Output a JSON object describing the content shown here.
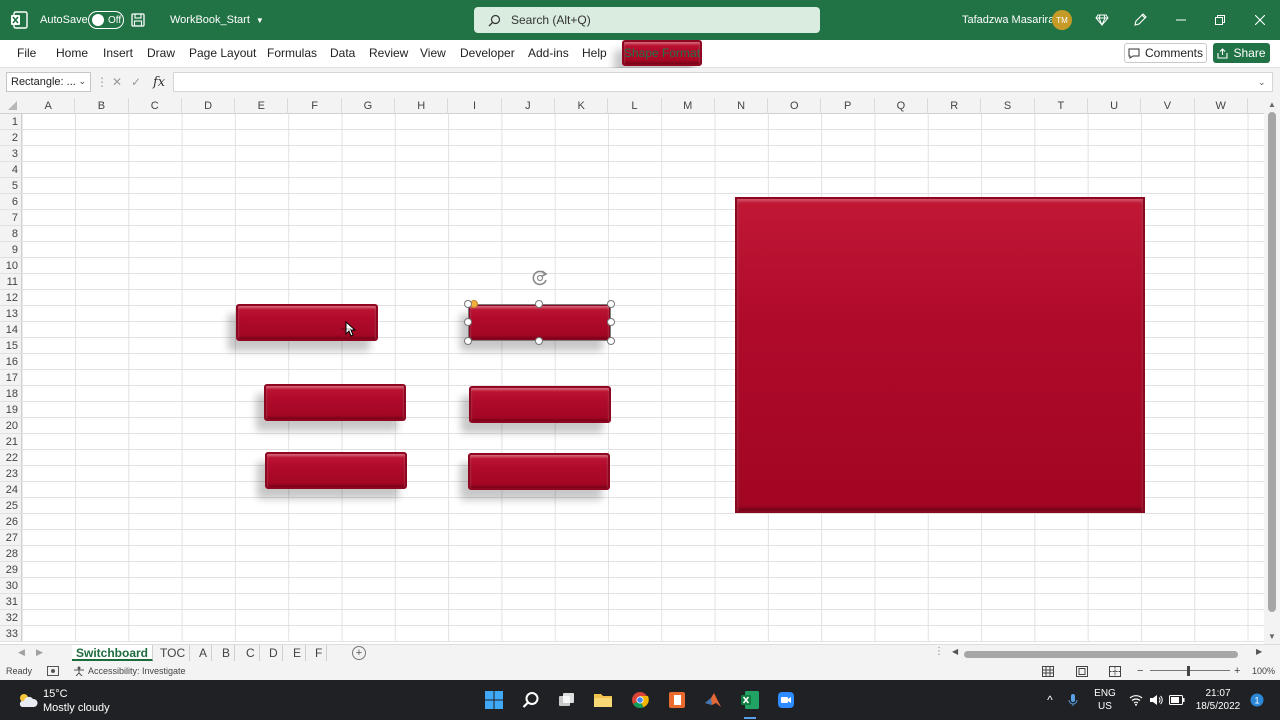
{
  "titlebar": {
    "autosave_label": "AutoSave",
    "autosave_state": "Off",
    "workbook_name": "WorkBook_Start",
    "search_placeholder": "Search (Alt+Q)",
    "user_name": "Tafadzwa Masarira",
    "user_initials": "TM",
    "accent_color": "#217346"
  },
  "ribbon": {
    "tabs": [
      "File",
      "Home",
      "Insert",
      "Draw",
      "Page Layout",
      "Formulas",
      "Data",
      "Review",
      "View",
      "Developer",
      "Add-ins",
      "Help",
      "Shape Format"
    ],
    "comments_label": "Comments",
    "share_label": "Share"
  },
  "formula_bar": {
    "name_box": "Rectangle: ...",
    "fx_label": "fx",
    "formula": ""
  },
  "grid": {
    "columns": [
      "A",
      "B",
      "C",
      "D",
      "E",
      "F",
      "G",
      "H",
      "I",
      "J",
      "K",
      "L",
      "M",
      "N",
      "O",
      "P",
      "Q",
      "R",
      "S",
      "T",
      "U",
      "V",
      "W"
    ],
    "rows": [
      "1",
      "2",
      "3",
      "4",
      "5",
      "6",
      "7",
      "8",
      "9",
      "10",
      "11",
      "12",
      "13",
      "14",
      "15",
      "16",
      "17",
      "18",
      "19",
      "20",
      "21",
      "22",
      "23",
      "24",
      "25",
      "26",
      "27",
      "28",
      "29",
      "30",
      "31",
      "32",
      "33"
    ],
    "shape_color": "#b10c2c"
  },
  "sheets": {
    "tabs": [
      "Switchboard",
      "TOC",
      "A",
      "B",
      "C",
      "D",
      "E",
      "F"
    ],
    "active": "Switchboard"
  },
  "statusbar": {
    "ready": "Ready",
    "accessibility": "Accessibility: Investigate",
    "zoom": "100%"
  },
  "taskbar": {
    "temperature": "15°C",
    "weather": "Mostly cloudy",
    "lang_1": "ENG",
    "lang_2": "US",
    "time": "21:07",
    "date": "18/5/2022"
  }
}
